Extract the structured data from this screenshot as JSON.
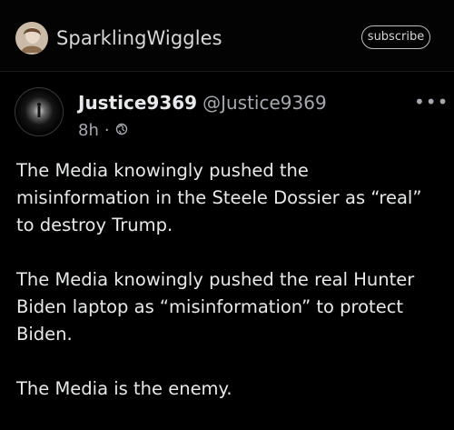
{
  "header": {
    "channel_name": "SparklingWiggles",
    "subscribe_label": "subscribe"
  },
  "post": {
    "author_name": "Justice9369",
    "author_handle": "@Justice9369",
    "time_ago": "8h",
    "separator": "·",
    "more_label": "•••",
    "paragraphs": [
      "The Media knowingly pushed the misinformation in the Steele Dossier as “real” to destroy Trump.",
      "The Media knowingly pushed the real Hunter Biden laptop as “misinformation” to protect Biden.",
      "The Media is the enemy."
    ]
  },
  "colors": {
    "background": "#000000",
    "text_primary": "#e7e9ea",
    "text_secondary": "#a5a9ad"
  }
}
